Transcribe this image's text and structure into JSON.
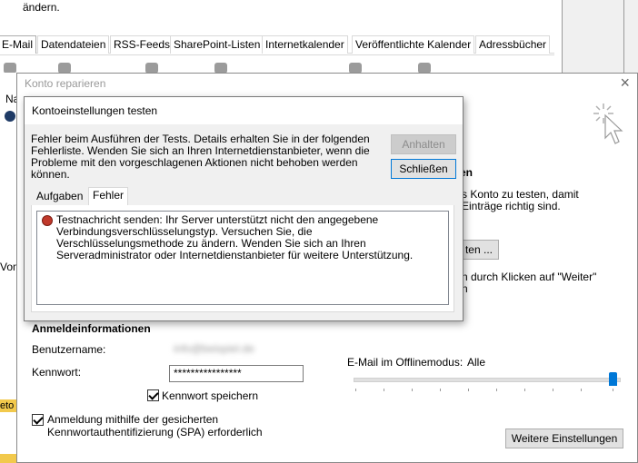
{
  "back_window": {
    "top_text": "ändern.",
    "tabs": [
      "E-Mail",
      "Datendateien",
      "RSS-Feeds",
      "SharePoint-Listen",
      "Internetkalender",
      "Veröffentlichte Kalender",
      "Adressbücher"
    ],
    "left_fragments": [
      "Na",
      "Vom",
      "eto"
    ]
  },
  "repair_dialog": {
    "title": "Konto reparieren",
    "close": "×",
    "right_heading": "en",
    "right_text_1": "s Konto zu testen, damit",
    "right_text_2": "Einträge richtig sind.",
    "test_button_partial": "ten ...",
    "right_text_3": "n durch Klicken auf \"Weiter\"",
    "right_text_4": "n",
    "logon_heading": "Anmeldeinformationen",
    "username_label": "Benutzername:",
    "username_value": "info@beispiel.de",
    "password_label": "Kennwort:",
    "password_value": "****************",
    "save_password_label": "Kennwort speichern",
    "spa_label_1": "Anmeldung mithilfe der gesicherten",
    "spa_label_2": "Kennwortauthentifizierung (SPA) erforderlich",
    "offline_label": "E-Mail im Offlinemodus:",
    "offline_value": "Alle",
    "more_settings_button": "Weitere Einstellungen"
  },
  "test_dialog": {
    "title": "Kontoeinstellungen testen",
    "message": "Fehler beim Ausführen der Tests. Details erhalten Sie in der folgenden Fehlerliste. Wenden Sie sich an Ihren Internetdienstanbieter, wenn die Probleme mit den vorgeschlagenen Aktionen nicht behoben werden können.",
    "stop_button": "Anhalten",
    "close_button": "Schließen",
    "tabs": [
      "Aufgaben",
      "Fehler"
    ],
    "error_text": "Testnachricht senden: Ihr Server unterstützt nicht den angegebene Verbindungsverschlüsselungstyp. Versuchen Sie, die Verschlüsselungsmethode zu ändern. Wenden Sie sich an Ihren Serveradministrator oder Internetdienstanbieter für weitere Unterstützung."
  },
  "colors": {
    "accent": "#0078d7",
    "error": "#c0392b"
  }
}
